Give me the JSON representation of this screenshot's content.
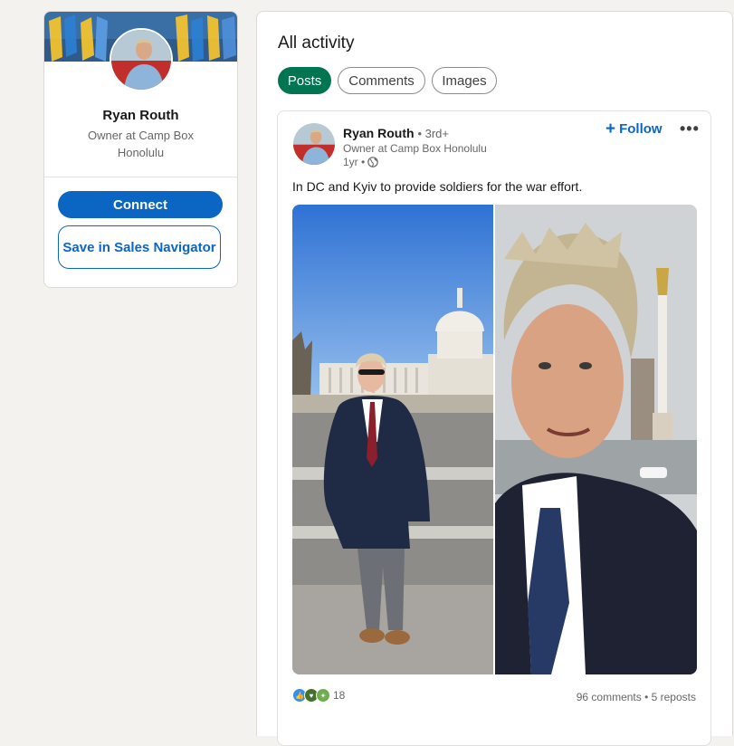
{
  "profile": {
    "name": "Ryan Routh",
    "headline": "Owner at Camp Box Honolulu",
    "connect_label": "Connect",
    "sales_nav_label": "Save in Sales Navigator"
  },
  "activity": {
    "title": "All activity",
    "tabs": [
      {
        "label": "Posts",
        "active": true
      },
      {
        "label": "Comments",
        "active": false
      },
      {
        "label": "Images",
        "active": false
      }
    ]
  },
  "post": {
    "author": "Ryan Routh",
    "degree": "• 3rd+",
    "headline": "Owner at Camp Box Honolulu",
    "time": "1yr •",
    "visibility_icon": "globe-icon",
    "follow_label": "Follow",
    "more_label": "•••",
    "text": "In DC and Kyiv to provide soldiers for the war effort.",
    "reaction_count": "18",
    "comments": "96 comments",
    "reposts": "• 5 reposts"
  },
  "colors": {
    "accent": "#0a66c2",
    "active_tab": "#01754f",
    "page_bg": "#f4f2ee"
  }
}
